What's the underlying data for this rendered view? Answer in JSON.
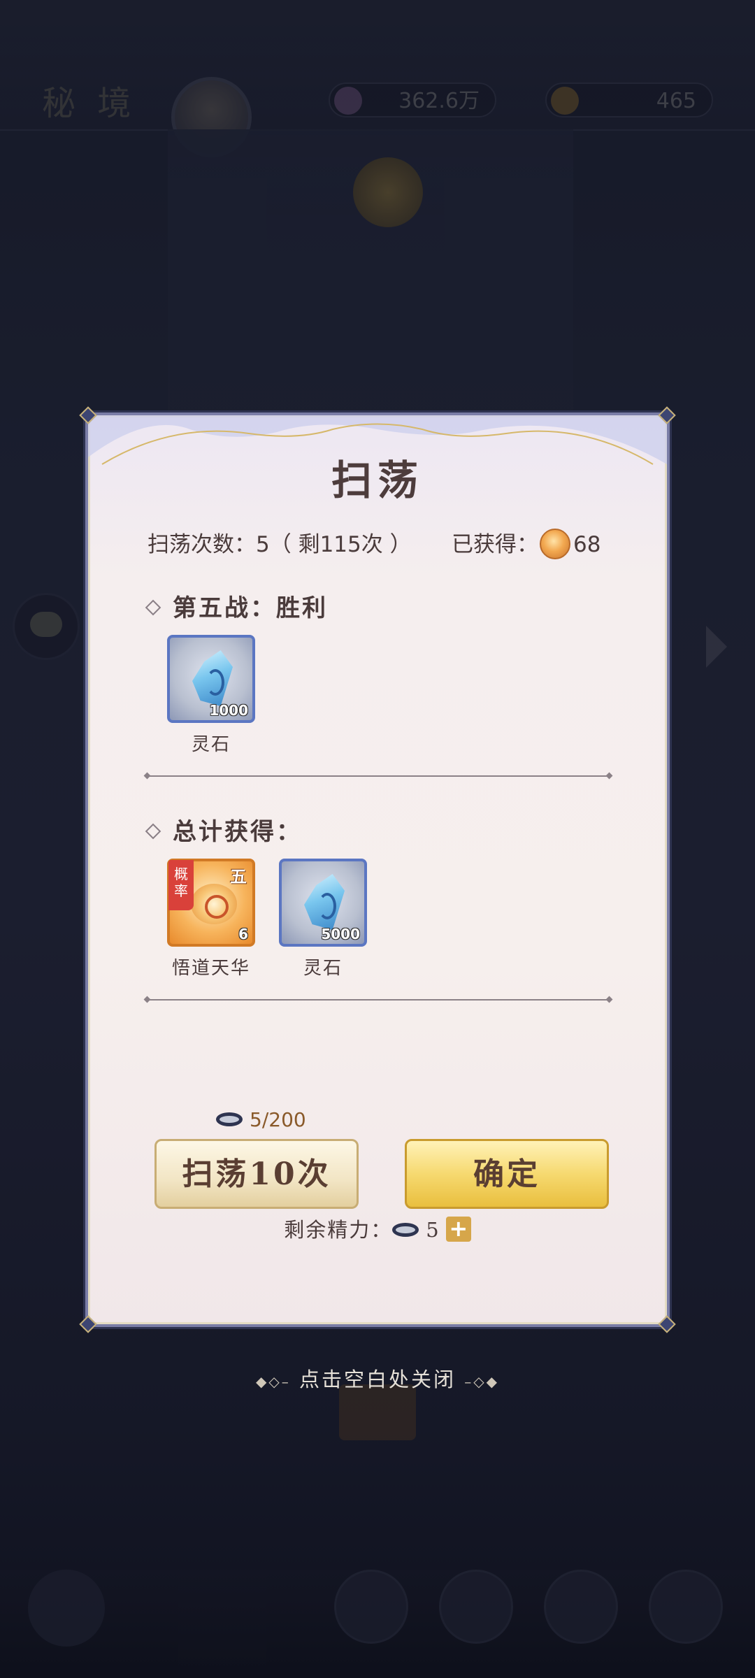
{
  "background": {
    "title": "秘 境",
    "resource_1": "362.6万",
    "resource_2": "465"
  },
  "modal": {
    "title": "扫荡",
    "sweep_count_label": "扫荡次数：",
    "sweep_count_value": "5（ 剩115次 ）",
    "obtained_label": "已获得：",
    "obtained_value": "68",
    "battle_section": {
      "title": "第五战：胜利",
      "items": [
        {
          "name": "灵石",
          "count": "1000",
          "icon": "spirit-stone-icon"
        }
      ]
    },
    "total_section": {
      "title": "总计获得：",
      "items": [
        {
          "name": "悟道天华",
          "count": "6",
          "icon": "wudao-tianhua-icon",
          "tag": "概率",
          "grade": "五"
        },
        {
          "name": "灵石",
          "count": "5000",
          "icon": "spirit-stone-icon"
        }
      ]
    },
    "cost": "5/200",
    "sweep_button": "扫荡10次",
    "confirm_button": "确定",
    "energy_label": "剩余精力：",
    "energy_value": "5",
    "plus_label": "+"
  },
  "close_hint": "点击空白处关闭",
  "colors": {
    "modal_border": "#7a7da7",
    "blue_frame": "#5b76c2",
    "orange_frame": "#d17a25",
    "prob_tag": "#d9413a",
    "confirm_gold": "#f6d970"
  }
}
